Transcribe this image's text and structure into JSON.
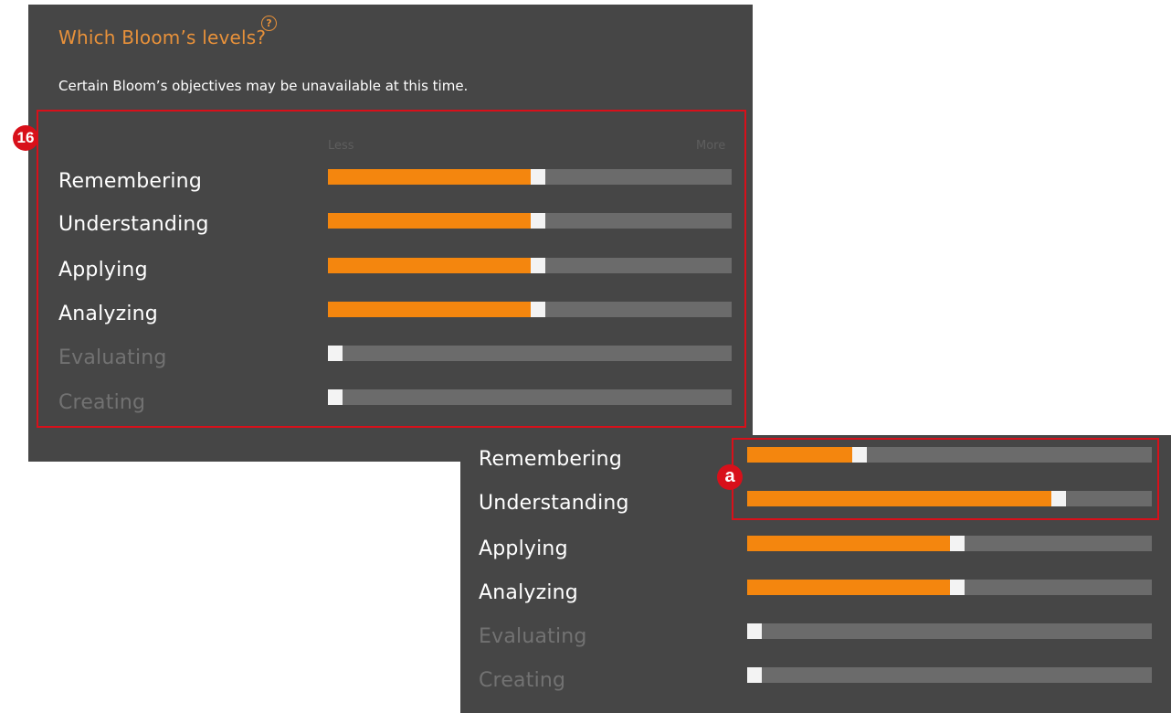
{
  "main_panel": {
    "title": "Which Bloom’s levels?",
    "help_icon": "question-circle-icon",
    "note": "Certain Bloom’s objectives may be unavailable at this time.",
    "callout": "16",
    "scale": {
      "less": "Less",
      "more": "More"
    },
    "levels": [
      {
        "label": "Remembering",
        "value": 0.52,
        "enabled": true
      },
      {
        "label": "Understanding",
        "value": 0.52,
        "enabled": true
      },
      {
        "label": "Applying",
        "value": 0.52,
        "enabled": true
      },
      {
        "label": "Analyzing",
        "value": 0.52,
        "enabled": true
      },
      {
        "label": "Evaluating",
        "value": 0.0,
        "enabled": false
      },
      {
        "label": "Creating",
        "value": 0.0,
        "enabled": false
      }
    ]
  },
  "zoom_panel": {
    "callout": "a",
    "levels": [
      {
        "label": "Remembering",
        "value": 0.27,
        "enabled": true
      },
      {
        "label": "Understanding",
        "value": 0.78,
        "enabled": true
      },
      {
        "label": "Applying",
        "value": 0.52,
        "enabled": true
      },
      {
        "label": "Analyzing",
        "value": 0.52,
        "enabled": true
      },
      {
        "label": "Evaluating",
        "value": 0.0,
        "enabled": false
      },
      {
        "label": "Creating",
        "value": 0.0,
        "enabled": false
      }
    ]
  },
  "colors": {
    "panel_bg": "#464646",
    "accent": "#f4860e",
    "title": "#e8913a",
    "track": "#6b6b6b",
    "callout": "#d8101a"
  }
}
